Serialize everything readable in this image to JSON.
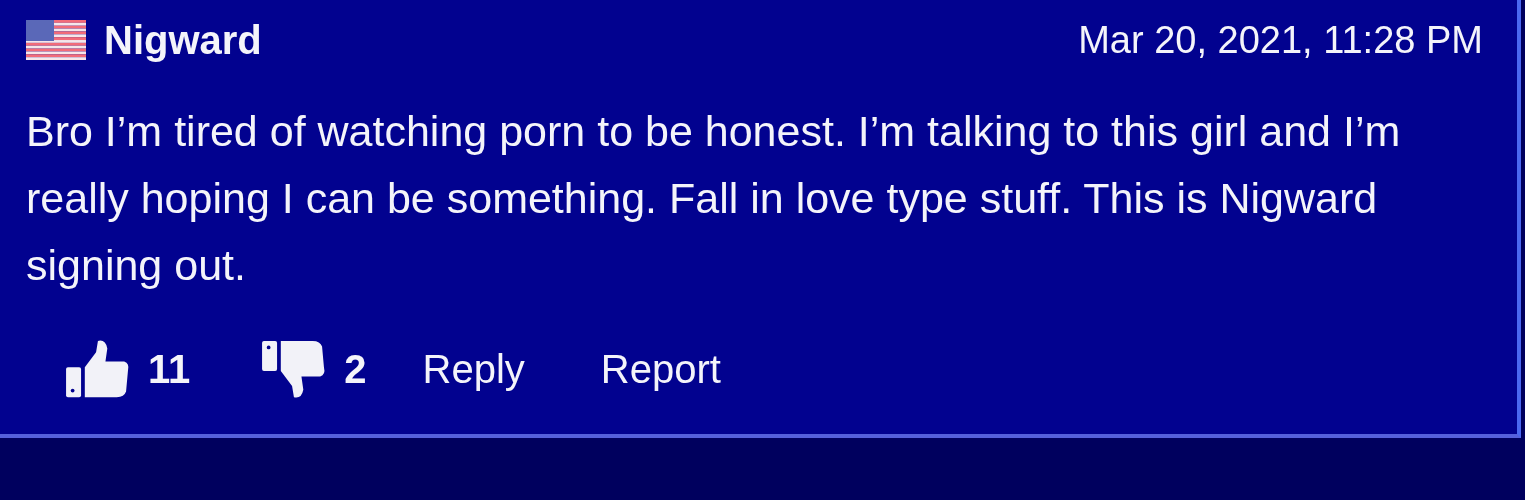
{
  "comment": {
    "author": "Nigward",
    "timestamp": "Mar 20, 2021, 11:28 PM",
    "body": "Bro I’m tired of watching porn to be honest. I’m talking to this girl and I’m really hoping I can be something. Fall in love type stuff. This is Nigward signing out.",
    "likes": "11",
    "dislikes": "2",
    "actions": [
      "Reply",
      "Report"
    ]
  }
}
